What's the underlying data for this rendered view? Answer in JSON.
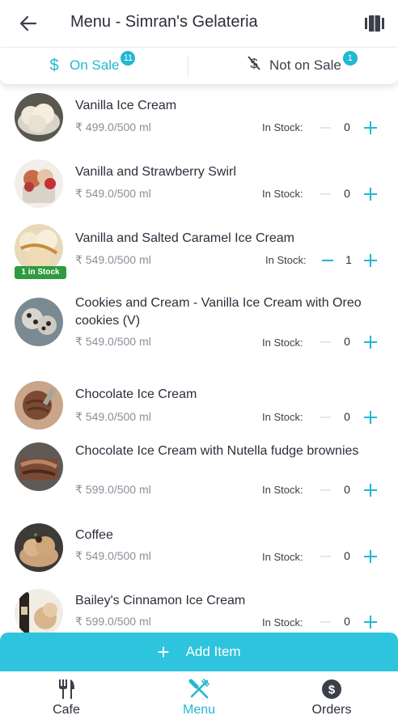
{
  "header": {
    "title": "Menu - Simran's Gelateria",
    "back_icon": "arrow-left-icon",
    "layout_icon": "view-columns-icon"
  },
  "tabs": {
    "on_sale": {
      "icon": "dollar-icon",
      "label": "On Sale",
      "count": "11"
    },
    "not_on_sale": {
      "icon": "dollar-off-icon",
      "label": "Not on Sale",
      "count": "1"
    }
  },
  "items": [
    {
      "name": "Vanilla Ice Cream",
      "price": "₹ 499.0/500 ml",
      "stock_label": "In Stock:",
      "qty": "0"
    },
    {
      "name": "Vanilla and Strawberry Swirl",
      "price": "₹ 549.0/500 ml",
      "stock_label": "In Stock:",
      "qty": "0"
    },
    {
      "name": "Vanilla and Salted Caramel Ice Cream",
      "price": "₹ 549.0/500 ml",
      "stock_label": "In Stock:",
      "qty": "1",
      "badge": "1 in Stock"
    },
    {
      "name": "Cookies and Cream - Vanilla Ice Cream with Oreo cookies (V)",
      "price": "₹ 549.0/500 ml",
      "stock_label": "In Stock:",
      "qty": "0"
    },
    {
      "name": "Chocolate Ice Cream",
      "price": "₹ 549.0/500 ml",
      "stock_label": "In Stock:",
      "qty": "0"
    },
    {
      "name": "Chocolate Ice Cream with Nutella fudge brownies",
      "price": "₹ 599.0/500 ml",
      "stock_label": "In Stock:",
      "qty": "0"
    },
    {
      "name": "Coffee",
      "price": "₹ 549.0/500 ml",
      "stock_label": "In Stock:",
      "qty": "0"
    },
    {
      "name": "Bailey's Cinnamon Ice Cream",
      "price": "₹ 599.0/500 ml",
      "stock_label": "In Stock:",
      "qty": "0"
    }
  ],
  "add_item": {
    "icon": "plus-icon",
    "label": "Add Item"
  },
  "nav": {
    "cafe": {
      "icon": "fork-knife-icon",
      "label": "Cafe"
    },
    "menu": {
      "icon": "crossed-utensils-icon",
      "label": "Menu"
    },
    "orders": {
      "icon": "dollar-circle-icon",
      "label": "Orders"
    }
  },
  "colors": {
    "accent": "#22b7d2",
    "add_button": "#2fc4dd",
    "stock_badge": "#2f9b3f",
    "price_text": "#8a8f99"
  }
}
